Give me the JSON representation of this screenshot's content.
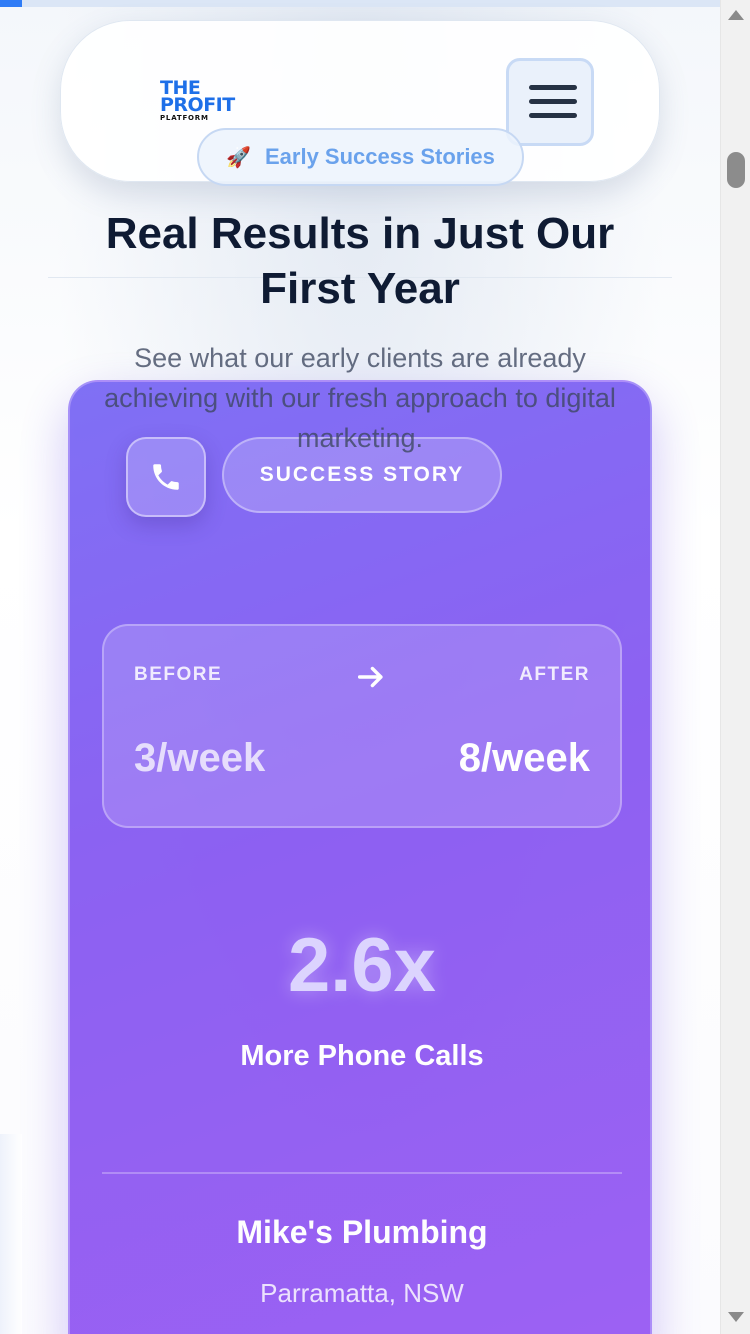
{
  "header": {
    "logo": {
      "line1": "THE",
      "line2": "PROFIT",
      "line3": "PLATFORM"
    },
    "menu_icon": "hamburger-menu-icon"
  },
  "hero": {
    "pill_icon": "rocket-icon",
    "pill_label": "Early Success Stories",
    "title": "Real Results in Just Our First Year",
    "subtitle": "See what our early clients are already achieving with our fresh approach to digital marketing."
  },
  "card": {
    "icon": "phone-icon",
    "tag": "SUCCESS STORY",
    "before_label": "BEFORE",
    "after_label": "AFTER",
    "arrow_icon": "arrow-right-icon",
    "before_value": "3/week",
    "after_value": "8/week",
    "stat_value": "2.6x",
    "stat_label": "More Phone Calls",
    "client_name": "Mike's Plumbing",
    "client_location": "Parramatta, NSW"
  },
  "colors": {
    "brand_blue": "#1e6fe8",
    "card_gradient_start": "#7c6cf4",
    "card_gradient_end": "#9a5df3",
    "title_color": "#0f1b33"
  }
}
